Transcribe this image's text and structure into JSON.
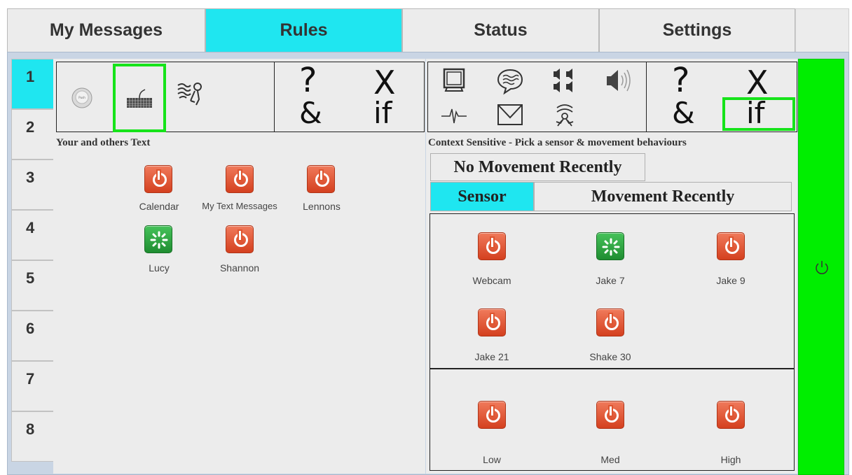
{
  "top_tabs": [
    {
      "label": "My Messages",
      "active": false
    },
    {
      "label": "Rules",
      "active": true
    },
    {
      "label": "Status",
      "active": false
    },
    {
      "label": "Settings",
      "active": false
    }
  ],
  "side_tabs": [
    "1",
    "2",
    "3",
    "4",
    "5",
    "6",
    "7",
    "8"
  ],
  "left_panel": {
    "toolbar_icons": [
      "push-button-icon",
      "keyboard-icon",
      "speech-wave-icon"
    ],
    "operators": {
      "question": "?",
      "x": "X",
      "and": "&",
      "if": "if"
    },
    "section_label": "Your and others Text",
    "items": [
      {
        "label": "Calendar",
        "state": "off"
      },
      {
        "label": "My Text Messages",
        "state": "off"
      },
      {
        "label": "Lennons",
        "state": "off"
      },
      {
        "label": "Lucy",
        "state": "loading"
      },
      {
        "label": "Shannon",
        "state": "off"
      }
    ]
  },
  "right_panel": {
    "toolbar_icons": [
      "monitor-icon",
      "chat-bubble-icon",
      "speakers-icon",
      "speaker-volume-icon",
      "heartbeat-icon",
      "envelope-icon",
      "motion-sensor-icon"
    ],
    "operators": {
      "question": "?",
      "x": "X",
      "and": "&",
      "if": "if"
    },
    "section_label": "Context Sensitive - Pick a sensor & movement behaviours",
    "mode_tabs_top": [
      "No Movement Recently"
    ],
    "mode_tabs_bottom": [
      {
        "label": "Sensor",
        "active": true
      },
      {
        "label": "Movement Recently",
        "active": false
      }
    ],
    "sensors": [
      {
        "label": "Webcam",
        "state": "off"
      },
      {
        "label": "Jake 7",
        "state": "loading"
      },
      {
        "label": "Jake 9",
        "state": "off"
      },
      {
        "label": "Jake 21",
        "state": "off"
      },
      {
        "label": "Shake 30",
        "state": "off"
      }
    ],
    "levels": [
      {
        "label": "Low",
        "state": "off"
      },
      {
        "label": "Med",
        "state": "off"
      },
      {
        "label": "High",
        "state": "off"
      }
    ]
  },
  "colors": {
    "active_tab": "#1fe6f0",
    "highlight": "#16e31a",
    "side_power_bar": "#00ee00"
  }
}
